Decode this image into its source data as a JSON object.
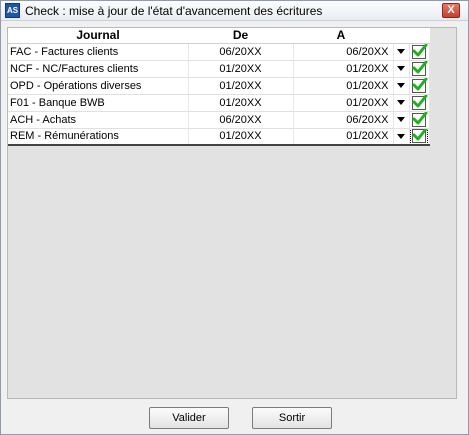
{
  "window": {
    "title": "Check : mise à jour de l'état d'avancement des écritures",
    "icon_name": "app-icon",
    "close_label": "X"
  },
  "grid": {
    "headers": {
      "journal": "Journal",
      "de": "De",
      "a": "A"
    },
    "rows": [
      {
        "journal": "FAC - Factures clients",
        "de": "06/20XX",
        "a": "06/20XX",
        "checked": true
      },
      {
        "journal": "NCF - NC/Factures clients",
        "de": "01/20XX",
        "a": "01/20XX",
        "checked": true
      },
      {
        "journal": "OPD - Opérations diverses",
        "de": "01/20XX",
        "a": "01/20XX",
        "checked": true
      },
      {
        "journal": "F01 - Banque BWB",
        "de": "01/20XX",
        "a": "01/20XX",
        "checked": true
      },
      {
        "journal": "ACH - Achats",
        "de": "06/20XX",
        "a": "06/20XX",
        "checked": true
      },
      {
        "journal": "REM - Rémunérations",
        "de": "01/20XX",
        "a": "01/20XX",
        "checked": true
      }
    ]
  },
  "buttons": {
    "validate": "Valider",
    "exit": "Sortir"
  },
  "colors": {
    "check": "#1db21d",
    "title_bg": "#e9edf3",
    "panel": "#e2e2e2"
  }
}
